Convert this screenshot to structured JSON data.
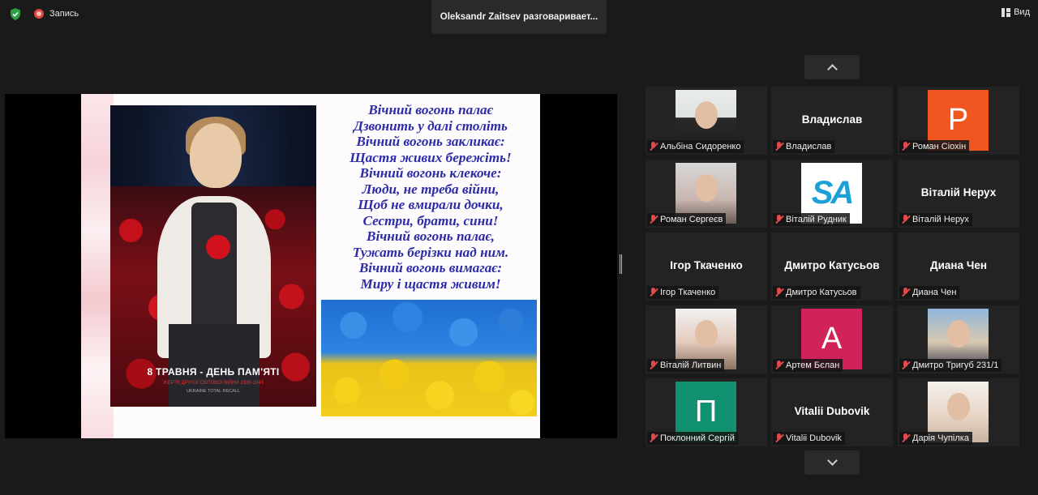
{
  "topbar": {
    "recording_label": "Запись",
    "speaking_text": "Oleksandr Zaitsev разговаривает...",
    "view_label": "Вид"
  },
  "slide": {
    "poem": [
      "Вічний вогонь палає",
      "Дзвонить у далі століть",
      "Вічний вогонь закликає:",
      "Щастя живих бережіть!",
      "Вічний вогонь клекоче:",
      "Люди, не треба війни,",
      "Щоб не вмирали дочки,",
      "Сестри, брати, сини!",
      "Вічний вогонь палає,",
      "Тужать берізки над ним.",
      "Вічний вогонь вимагає:",
      "Миру і щастя живим!"
    ],
    "caption_main": "8 ТРАВНЯ - ДЕНЬ ПАМ'ЯТІ",
    "caption_sub": "ЖЕРТВ ДРУГОЇ СВІТОВОЇ ВІЙНИ 1939-1945",
    "caption_sub2": "UKRAINE TOTAL RECALL"
  },
  "participants": [
    {
      "label": "Альбіна Сидоренко",
      "type": "photo",
      "photo": "photo-a"
    },
    {
      "label": "Владислав",
      "type": "name",
      "name": "Владислав"
    },
    {
      "label": "Роман Сіохін",
      "type": "letter",
      "letter": "P",
      "color": "#f0561f"
    },
    {
      "label": "Роман Сергеєв",
      "type": "photo",
      "photo": "photo-b"
    },
    {
      "label": "Віталій Рудник",
      "type": "logo",
      "logo_text": "SA"
    },
    {
      "label": "Віталій Нерух",
      "type": "name",
      "name": "Віталій Нерух"
    },
    {
      "label": "Ігор Ткаченко",
      "type": "name",
      "name": "Ігор Ткаченко"
    },
    {
      "label": "Дмитро Катусьов",
      "type": "name",
      "name": "Дмитро Катусьов"
    },
    {
      "label": "Диана Чен",
      "type": "name",
      "name": "Диана Чен"
    },
    {
      "label": "Віталій Литвин",
      "type": "photo",
      "photo": "photo-c"
    },
    {
      "label": "Артем Бєлан",
      "type": "letter",
      "letter": "A",
      "color": "#d0235a"
    },
    {
      "label": "Дмитро Тригуб 231/1",
      "type": "photo",
      "photo": "photo-d"
    },
    {
      "label": "Поклонний Сергій",
      "type": "letter",
      "letter": "П",
      "color": "#129170"
    },
    {
      "label": "Vitalii Dubovik",
      "type": "name",
      "name": "Vitalii Dubovik"
    },
    {
      "label": "Дарія Чупілка",
      "type": "photo",
      "photo": "photo-e"
    }
  ],
  "colors": {
    "background": "#1a1a1a",
    "tile": "#232323",
    "muted_mic": "#e04a4a",
    "poem_text": "#2c2ba8",
    "record": "#e0463e",
    "shield": "#2ea043"
  },
  "icons": {
    "security": "shield-icon",
    "recording": "record-icon",
    "view": "grid-view-icon",
    "mic": "muted-mic-icon",
    "up": "chevron-up-icon",
    "down": "chevron-down-icon"
  }
}
